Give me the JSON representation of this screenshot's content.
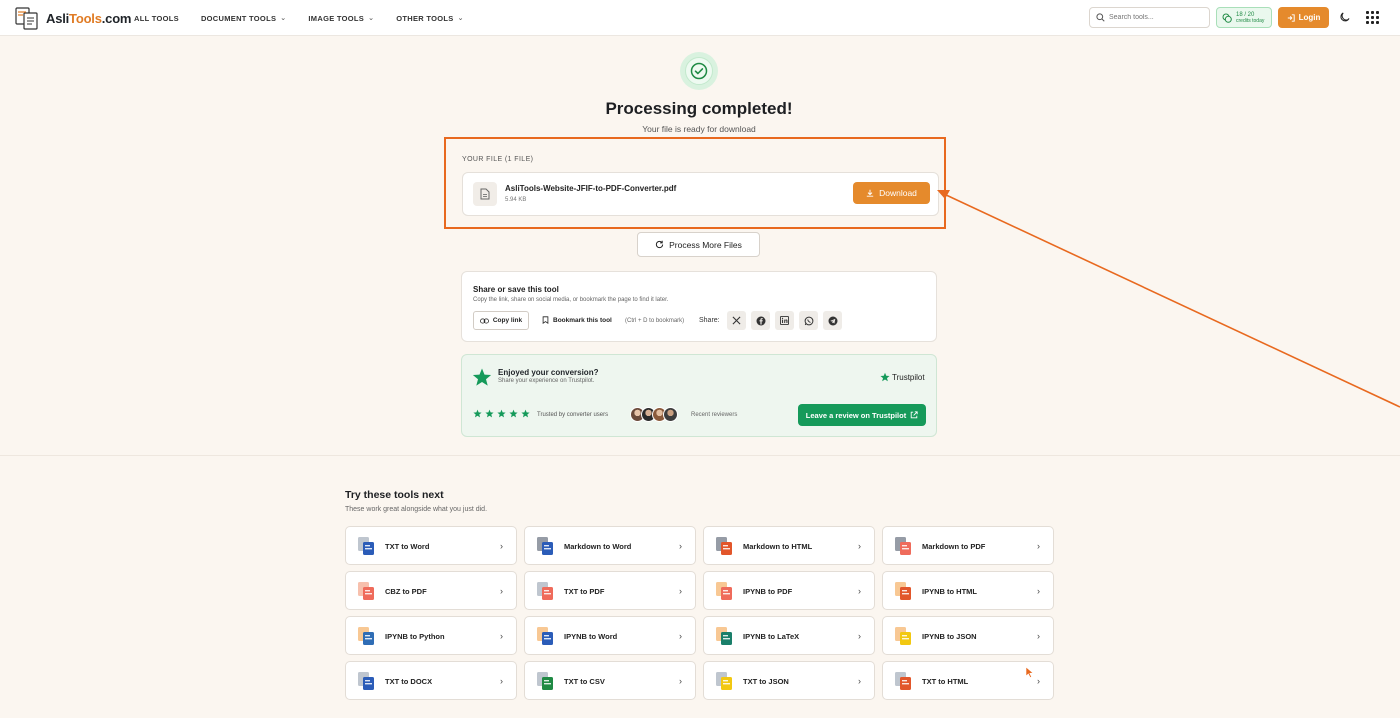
{
  "header": {
    "logo": {
      "text_main": "Asli",
      "text_accent": "Tools",
      "text_tail": ".com"
    },
    "nav": [
      {
        "label": "ALL TOOLS",
        "has_chevron": false
      },
      {
        "label": "DOCUMENT TOOLS",
        "has_chevron": true
      },
      {
        "label": "IMAGE TOOLS",
        "has_chevron": true
      },
      {
        "label": "OTHER TOOLS",
        "has_chevron": true
      }
    ],
    "search_placeholder": "Search tools...",
    "credits_count": "18 / 20",
    "credits_label": "credits today",
    "login_label": "Login"
  },
  "success": {
    "title": "Processing completed!",
    "subtitle": "Your file is ready for download"
  },
  "file_section": {
    "label": "YOUR FILE (1 FILE)",
    "file_name": "AsliTools-Website-JFIF-to-PDF-Converter.pdf",
    "file_size": "5.94 KB",
    "download_label": "Download"
  },
  "process_more_label": "Process More Files",
  "share": {
    "title": "Share or save this tool",
    "description": "Copy the link, share on social media, or bookmark the page to find it later.",
    "copy_label": "Copy link",
    "bookmark_label": "Bookmark this tool",
    "bookmark_hint": "(Ctrl + D to bookmark)",
    "share_label": "Share:",
    "networks": [
      "x-icon",
      "facebook-icon",
      "linkedin-icon",
      "whatsapp-icon",
      "telegram-icon"
    ]
  },
  "review": {
    "title": "Enjoyed your conversion?",
    "subtitle": "Share your experience on Trustpilot.",
    "brand": "Trustpilot",
    "trusted_text": "Trusted by converter users",
    "recent_text": "Recent reviewers",
    "button_label": "Leave a review on Trustpilot",
    "star_count": 5
  },
  "tools": {
    "title": "Try these tools next",
    "subtitle": "These work great alongside what you just did.",
    "items": [
      {
        "label": "TXT to Word",
        "from_color": "#8a97a8",
        "to_color": "#2b5cb8"
      },
      {
        "label": "Markdown to Word",
        "from_color": "#3f4a5c",
        "to_color": "#2b5cb8"
      },
      {
        "label": "Markdown to HTML",
        "from_color": "#3f4a5c",
        "to_color": "#e2562b"
      },
      {
        "label": "Markdown to PDF",
        "from_color": "#3f4a5c",
        "to_color": "#ef6b5b"
      },
      {
        "label": "CBZ to PDF",
        "from_color": "#f08c6a",
        "to_color": "#ef6b5b"
      },
      {
        "label": "TXT to PDF",
        "from_color": "#8a97a8",
        "to_color": "#ef6b5b"
      },
      {
        "label": "IPYNB to PDF",
        "from_color": "#f39a3c",
        "to_color": "#ef6b5b"
      },
      {
        "label": "IPYNB to HTML",
        "from_color": "#f39a3c",
        "to_color": "#e2562b"
      },
      {
        "label": "IPYNB to Python",
        "from_color": "#f39a3c",
        "to_color": "#2f6db5"
      },
      {
        "label": "IPYNB to Word",
        "from_color": "#f39a3c",
        "to_color": "#2b5cb8"
      },
      {
        "label": "IPYNB to LaTeX",
        "from_color": "#f39a3c",
        "to_color": "#1a7f6a"
      },
      {
        "label": "IPYNB to JSON",
        "from_color": "#f39a3c",
        "to_color": "#f2c811"
      },
      {
        "label": "TXT to DOCX",
        "from_color": "#8a97a8",
        "to_color": "#2b5cb8"
      },
      {
        "label": "TXT to CSV",
        "from_color": "#8a97a8",
        "to_color": "#1f8a44"
      },
      {
        "label": "TXT to JSON",
        "from_color": "#8a97a8",
        "to_color": "#f2c811"
      },
      {
        "label": "TXT to HTML",
        "from_color": "#8a97a8",
        "to_color": "#e2562b"
      }
    ]
  },
  "colors": {
    "accent": "#e58a2c",
    "annotation": "#e8691f",
    "success": "#1f8a44",
    "trustpilot": "#159a5a"
  }
}
